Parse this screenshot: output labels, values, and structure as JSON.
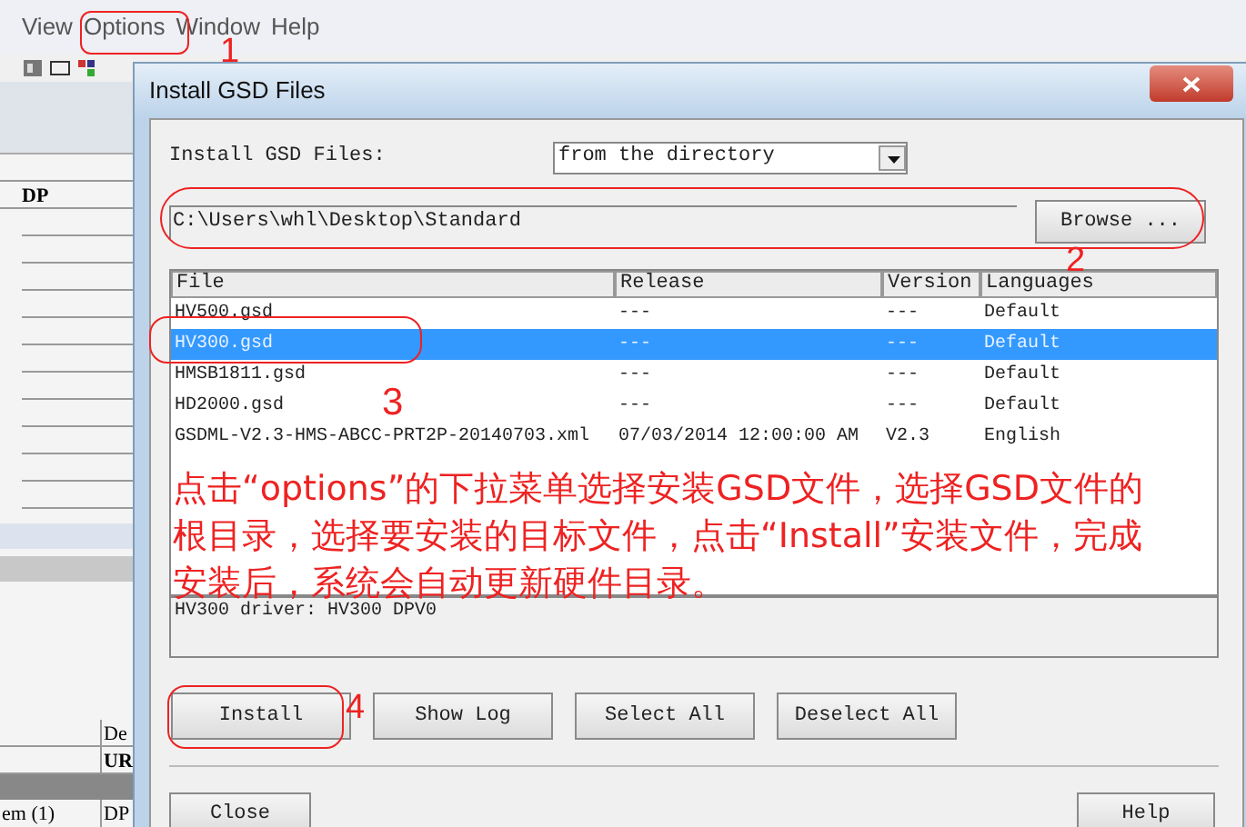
{
  "menu_bar": {
    "items": [
      {
        "label": "View"
      },
      {
        "label": "Options"
      },
      {
        "label": "Window"
      },
      {
        "label": "Help"
      }
    ]
  },
  "background_panel": {
    "column_1_texts": [
      "DP"
    ],
    "bottom_table": {
      "header": "De",
      "rows": [
        {
          "column_2": "UR"
        },
        {
          "column_1": "em (1)",
          "column_2": "DP"
        }
      ]
    }
  },
  "dialog": {
    "title": "Install GSD Files",
    "source_label": "Install GSD Files:",
    "source_select": "from the directory",
    "path": "C:\\Users\\whl\\Desktop\\Standard",
    "browse_button": "Browse ...",
    "columns": [
      "File",
      "Release",
      "Version",
      "Languages"
    ],
    "rows": [
      {
        "file": "HV500.gsd",
        "release": "---",
        "version": "---",
        "languages": "Default",
        "selected": false
      },
      {
        "file": "HV300.gsd",
        "release": "---",
        "version": "---",
        "languages": "Default",
        "selected": true
      },
      {
        "file": "HMSB1811.gsd",
        "release": "---",
        "version": "---",
        "languages": "Default",
        "selected": false
      },
      {
        "file": "HD2000.gsd",
        "release": "---",
        "version": "---",
        "languages": "Default",
        "selected": false
      },
      {
        "file": "GSDML-V2.3-HMS-ABCC-PRT2P-20140703.xml",
        "release": "07/03/2014 12:00:00 AM",
        "version": "V2.3",
        "languages": "English",
        "selected": false
      }
    ],
    "description": "HV300 driver: HV300 DPV0",
    "buttons": [
      "Install",
      "Show Log",
      "Select All",
      "Deselect All"
    ],
    "footer_buttons": [
      "Close",
      "Help"
    ]
  },
  "annotations": {
    "markers": [
      "1",
      "2",
      "3",
      "4"
    ],
    "note": "点击“options”的下拉菜单选择安装GSD文件，选择GSD文件的根目录，选择要安装的目标文件，点击“Install”安装文件，完成安装后，系统会自动更新硬件目录。"
  }
}
